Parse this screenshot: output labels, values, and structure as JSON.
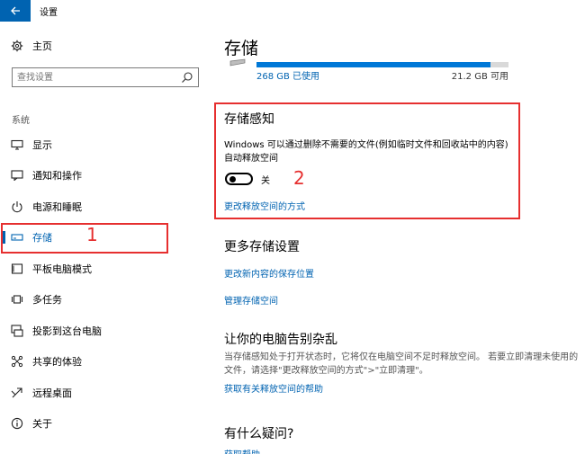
{
  "window": {
    "title": "设置",
    "back_icon": "arrow-left-icon"
  },
  "sidebar": {
    "home_label": "主页",
    "search_placeholder": "查找设置",
    "section_label": "系统",
    "items": [
      {
        "label": "显示",
        "icon": "monitor-icon"
      },
      {
        "label": "通知和操作",
        "icon": "notification-icon"
      },
      {
        "label": "电源和睡眠",
        "icon": "power-icon"
      },
      {
        "label": "存储",
        "icon": "storage-icon",
        "active": true
      },
      {
        "label": "平板电脑模式",
        "icon": "tablet-icon"
      },
      {
        "label": "多任务",
        "icon": "multitask-icon"
      },
      {
        "label": "投影到这台电脑",
        "icon": "project-icon"
      },
      {
        "label": "共享的体验",
        "icon": "share-icon"
      },
      {
        "label": "远程桌面",
        "icon": "remote-desktop-icon"
      },
      {
        "label": "关于",
        "icon": "info-icon"
      }
    ]
  },
  "annotations": {
    "num1": "1",
    "num2": "2",
    "color": "#e62f2f"
  },
  "main": {
    "title": "存储",
    "drive": {
      "used": "268 GB 已使用",
      "free": "21.2 GB 可用",
      "used_fraction": 0.927
    },
    "storage_sense": {
      "heading": "存储感知",
      "description": "Windows 可以通过删除不需要的文件(例如临时文件和回收站中的内容)自动释放空间",
      "toggle_state": "关",
      "link": "更改释放空间的方式"
    },
    "more_settings": {
      "heading": "更多存储设置",
      "link1": "更改新内容的保存位置",
      "link2": "管理存储空间"
    },
    "declutter": {
      "heading": "让你的电脑告别杂乱",
      "description": "当存储感知处于打开状态时，它将仅在电脑空间不足时释放空间。 若要立即清理未使用的文件，请选择\"更改释放空间的方式\">\"立即清理\"。",
      "link": "获取有关释放空间的帮助"
    },
    "questions": {
      "heading": "有什么疑问?",
      "link": "获取帮助"
    }
  },
  "accent_color": "#0063b1"
}
